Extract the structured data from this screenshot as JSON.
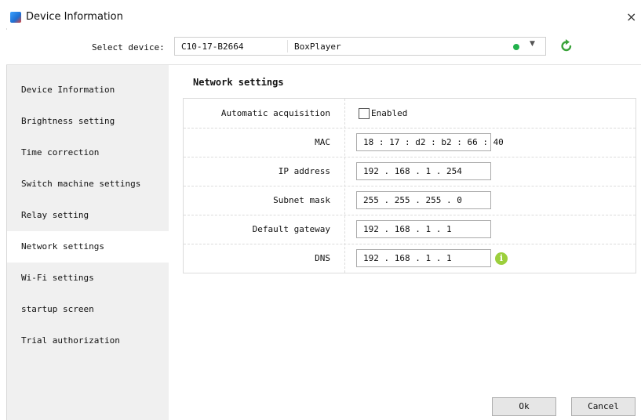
{
  "window": {
    "title": "Device Information",
    "close_glyph": "×"
  },
  "device_selector": {
    "label": "Select device:",
    "device_id": "C10-17-B2664",
    "device_type": "BoxPlayer",
    "status_color": "#22b14c",
    "dropdown_icon": "chevron-down-icon",
    "refresh_icon": "refresh-icon"
  },
  "sidebar": {
    "items": [
      {
        "label": "Device Information"
      },
      {
        "label": "Brightness setting"
      },
      {
        "label": "Time correction"
      },
      {
        "label": "Switch machine settings"
      },
      {
        "label": "Relay setting"
      },
      {
        "label": "Network settings",
        "active": true
      },
      {
        "label": "Wi-Fi settings"
      },
      {
        "label": "startup screen"
      },
      {
        "label": "Trial authorization"
      }
    ]
  },
  "network": {
    "title": "Network settings",
    "auto": {
      "label": "Automatic acquisition",
      "checkbox_label": "Enabled",
      "checked": false
    },
    "mac": {
      "label": "MAC",
      "value": "18 : 17 : d2 : b2 : 66 : 40"
    },
    "ip": {
      "label": "IP address",
      "value": "192 .  168 .   1   .  254"
    },
    "subnet": {
      "label": "Subnet mask",
      "value": "255 .  255 .  255 .   0"
    },
    "gateway": {
      "label": "Default gateway",
      "value": "192 .  168 .   1   .   1"
    },
    "dns": {
      "label": "DNS",
      "value": "192 .  168 .   1   .   1",
      "info_glyph": "i"
    }
  },
  "buttons": {
    "ok": "Ok",
    "cancel": "Cancel"
  }
}
